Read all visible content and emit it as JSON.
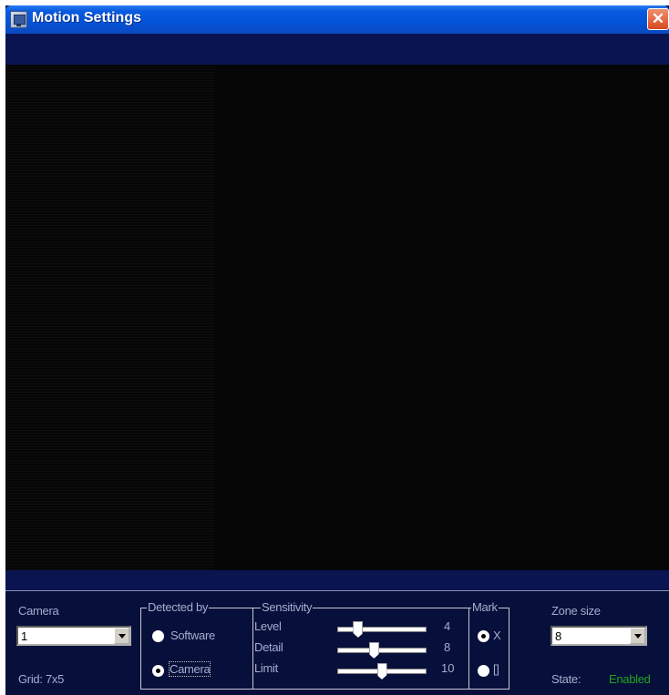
{
  "window": {
    "title": "Motion Settings",
    "close_glyph": "✕"
  },
  "camera": {
    "label": "Camera",
    "value": "1"
  },
  "grid": {
    "text": "Grid: 7x5"
  },
  "detected_by": {
    "label": "Detected by",
    "options": [
      {
        "label": "Software",
        "checked": false
      },
      {
        "label": "Camera",
        "checked": true
      }
    ]
  },
  "sensitivity": {
    "label": "Sensitivity",
    "sliders": [
      {
        "label": "Level",
        "value": "4",
        "max": 20
      },
      {
        "label": "Detail",
        "value": "8",
        "max": 20
      },
      {
        "label": "Limit",
        "value": "10",
        "max": 20
      }
    ]
  },
  "mark": {
    "label": "Mark",
    "options": [
      {
        "label": "X",
        "checked": true
      },
      {
        "label": "[]",
        "checked": false
      }
    ]
  },
  "zone_size": {
    "label": "Zone size",
    "value": "8"
  },
  "state": {
    "label": "State:",
    "value": "Enabled",
    "value_color": "#1fa41f"
  }
}
